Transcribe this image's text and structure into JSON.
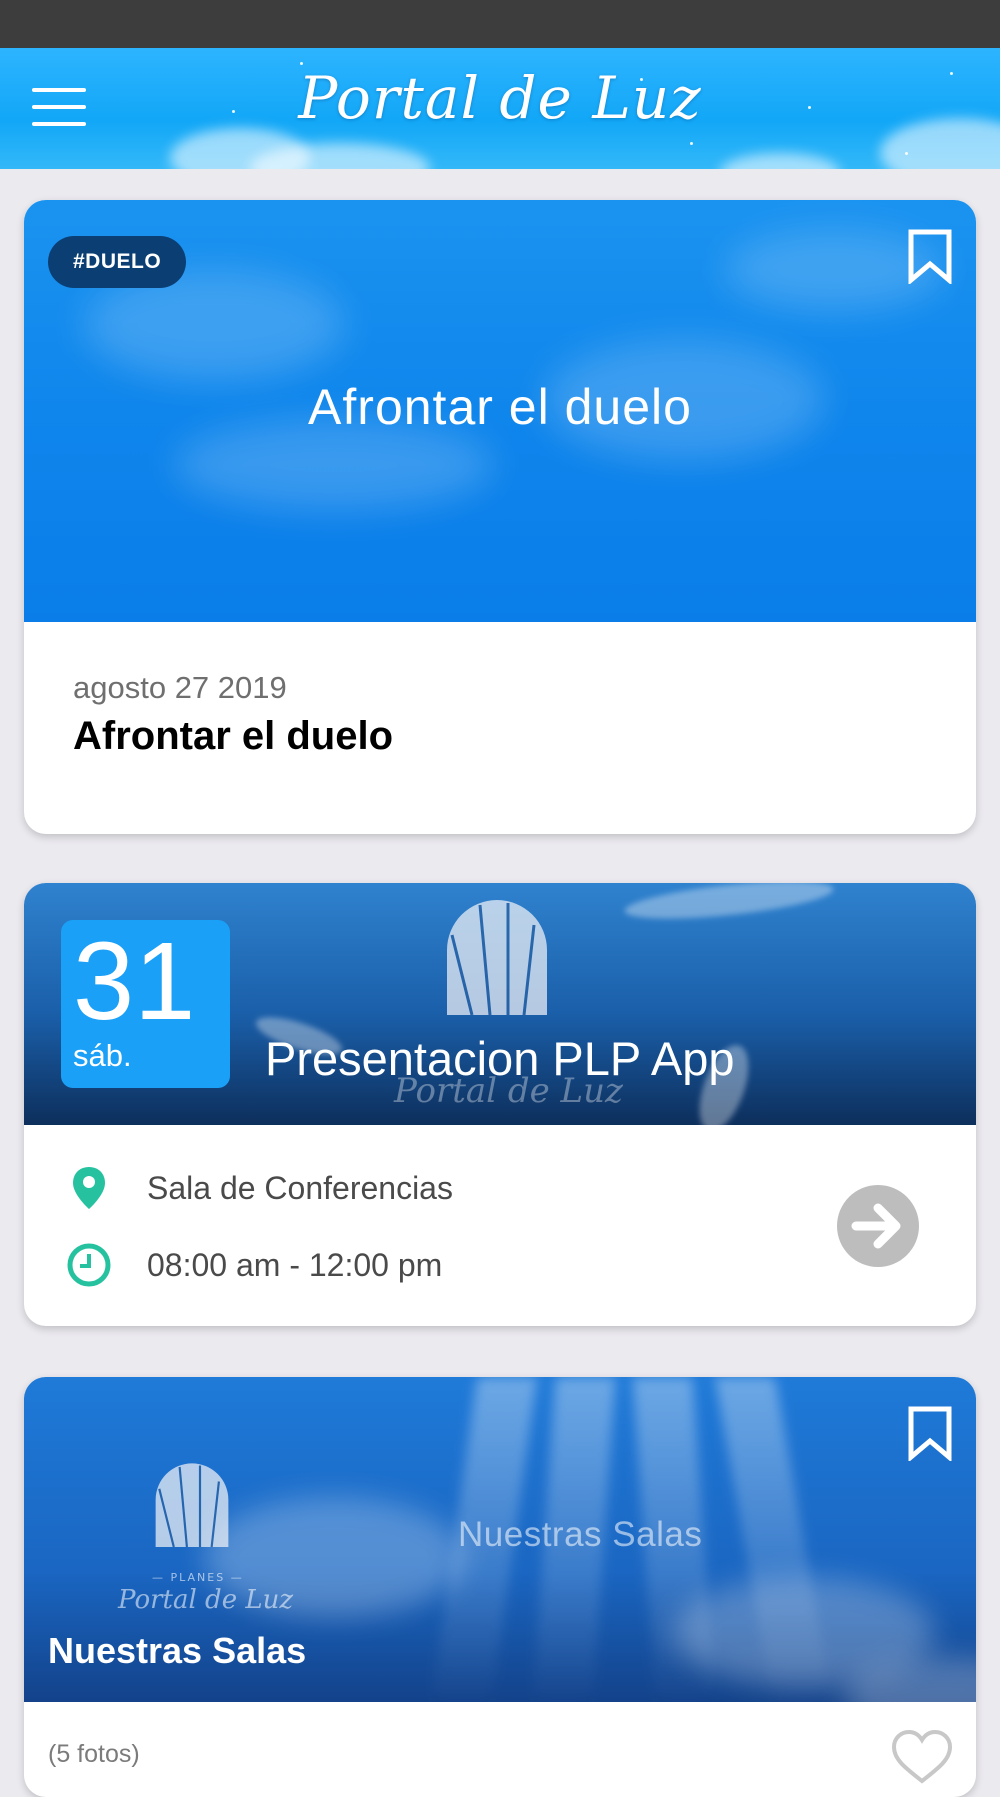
{
  "app": {
    "brand_name": "Portal de Luz"
  },
  "header": {
    "menu_icon": "hamburger-menu-icon"
  },
  "post_card": {
    "tag": "#DUELO",
    "image_caption": "Afrontar el duelo",
    "date": "agosto 27 2019",
    "title": "Afrontar el duelo",
    "bookmark_icon": "bookmark-outline-icon"
  },
  "event_card": {
    "day": "31",
    "weekday": "sáb.",
    "title": "Presentacion PLP App",
    "location": "Sala de Conferencias",
    "time": "08:00 am - 12:00 pm",
    "location_icon": "location-pin-icon",
    "time_icon": "clock-icon",
    "action_icon": "arrow-right-circle-icon"
  },
  "gallery_card": {
    "logo_small_label": "— PLANES —",
    "logo_text": "Portal de Luz",
    "image_caption": "Nuestras Salas",
    "title": "Nuestras Salas",
    "photo_count": "(5 fotos)",
    "bookmark_icon": "bookmark-outline-icon",
    "heart_icon": "heart-outline-icon"
  },
  "colors": {
    "status_bar": "#3d3d3d",
    "app_bar": "#12a7f7",
    "tag_chip": "#0b3f74",
    "date_box": "#1aa0f7",
    "info_icon_teal": "#26c2a0",
    "action_gray": "#bdbdbd",
    "page_bg": "#ebeaef"
  }
}
